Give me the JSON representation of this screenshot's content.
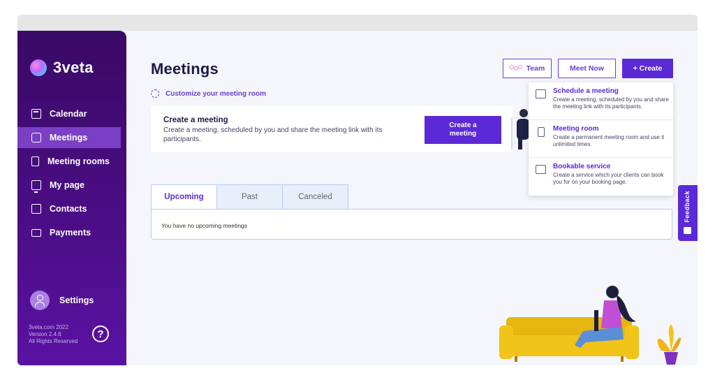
{
  "app": {
    "name": "3veta"
  },
  "sidebar": {
    "items": [
      {
        "label": "Calendar",
        "icon": "calendar-icon",
        "active": false
      },
      {
        "label": "Meetings",
        "icon": "chat-icon",
        "active": true
      },
      {
        "label": "Meeting rooms",
        "icon": "door-icon",
        "active": false
      },
      {
        "label": "My page",
        "icon": "monitor-icon",
        "active": false
      },
      {
        "label": "Contacts",
        "icon": "contact-icon",
        "active": false
      },
      {
        "label": "Payments",
        "icon": "payment-card-icon",
        "active": false
      }
    ],
    "settings_label": "Settings",
    "footer": {
      "copyright": "3veta.com 2022",
      "version": "Version 2.4.6",
      "rights": "All Rights Reserved"
    },
    "help_label": "?"
  },
  "header": {
    "title": "Meetings",
    "customize_link": "Customize your meeting room",
    "team_label": "Team",
    "meet_now_label": "Meet Now",
    "create_label": "+ Create"
  },
  "create_card": {
    "title": "Create a meeting",
    "description": "Create a meeting, scheduled by you and share the meeting link with its participants.",
    "button_line1": "Create a",
    "button_line2": "meeting"
  },
  "tabs": [
    {
      "label": "Upcoming",
      "active": true
    },
    {
      "label": "Past",
      "active": false
    },
    {
      "label": "Canceled",
      "active": false
    }
  ],
  "tab_panel": {
    "empty_text": "You have no upcoming meetings"
  },
  "create_menu": {
    "items": [
      {
        "title": "Schedule a meeting",
        "description": "Create a meeting, scheduled by you and share the meeting link with its participants.",
        "icon": "chat-icon"
      },
      {
        "title": "Meeting room",
        "description": "Create a permanent meeting room and use it unlimited times.",
        "icon": "door-icon"
      },
      {
        "title": "Bookable service",
        "description": "Create a service which your clients can book you for on your booking page.",
        "icon": "monitor-icon"
      }
    ]
  },
  "feedback_label": "Feedback",
  "colors": {
    "sidebar_top": "#3a0a66",
    "sidebar_bottom": "#5a12a3",
    "active_nav": "#7a3fc4",
    "accent": "#5b2ad6",
    "title": "#1b1b4b",
    "background": "#f4f6fb"
  }
}
